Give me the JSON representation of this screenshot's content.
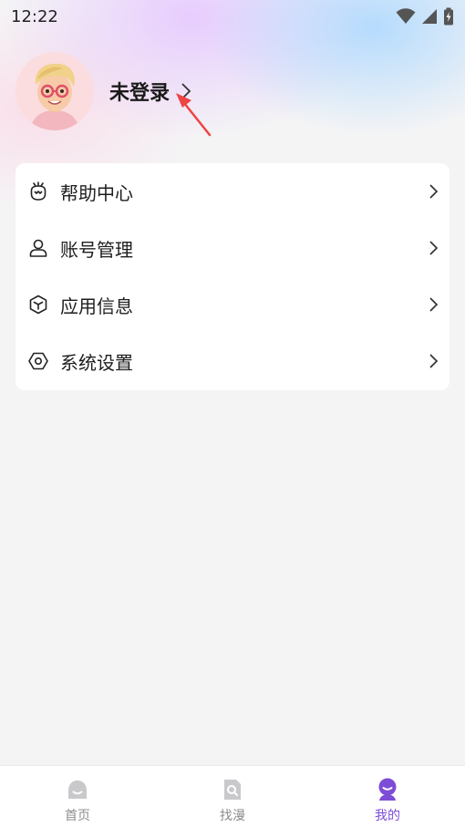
{
  "status_bar": {
    "time": "12:22"
  },
  "profile": {
    "login_label": "未登录"
  },
  "menu": {
    "items": [
      {
        "label": "帮助中心",
        "icon": "help-center-icon"
      },
      {
        "label": "账号管理",
        "icon": "account-icon"
      },
      {
        "label": "应用信息",
        "icon": "app-info-icon"
      },
      {
        "label": "系统设置",
        "icon": "settings-icon"
      }
    ]
  },
  "tabbar": {
    "tabs": [
      {
        "label": "首页",
        "icon": "home-icon",
        "active": false
      },
      {
        "label": "找漫",
        "icon": "search-comic-icon",
        "active": false
      },
      {
        "label": "我的",
        "icon": "profile-icon",
        "active": true
      }
    ]
  },
  "colors": {
    "accent": "#7d4dd8",
    "annotation": "#ee4444",
    "tab_inactive": "#8c8c8c"
  }
}
